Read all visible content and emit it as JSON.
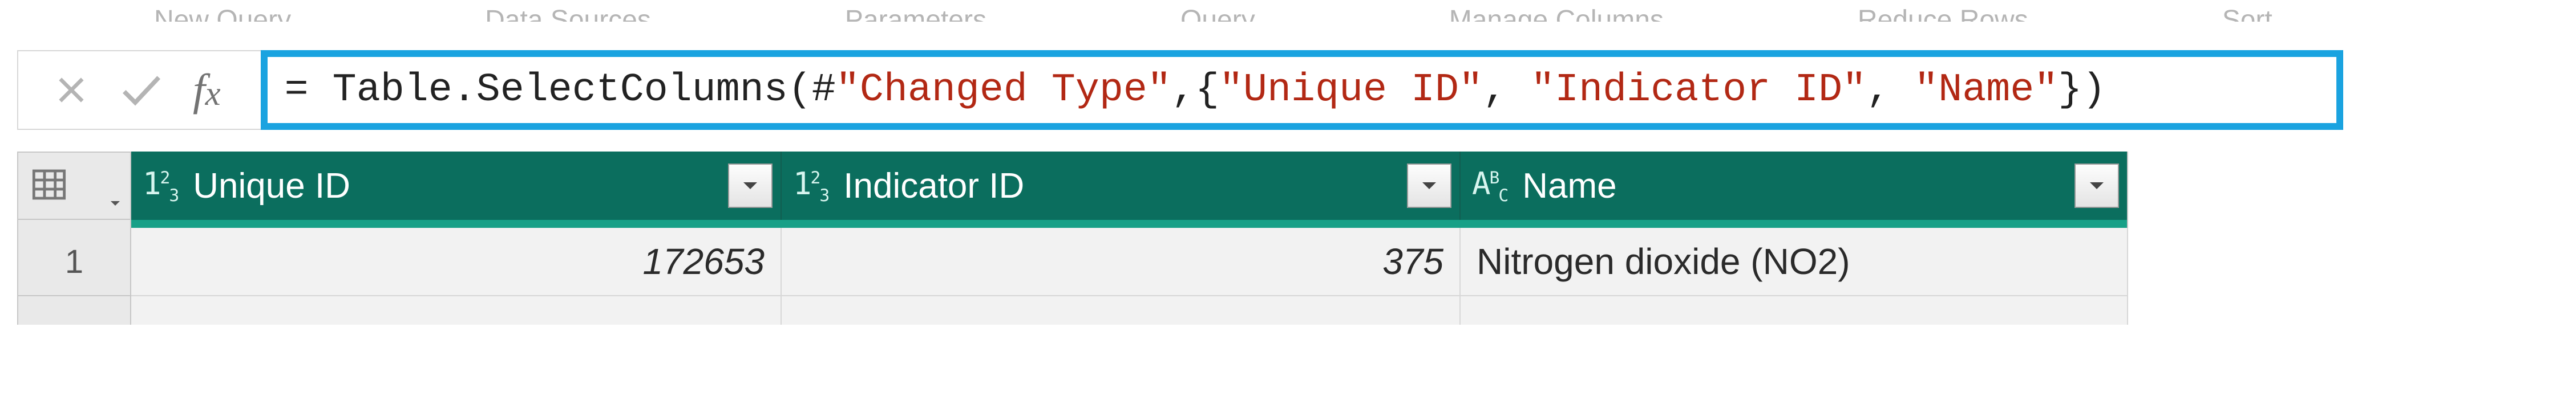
{
  "ribbon": {
    "items": [
      "New Query",
      "Data Sources",
      "Parameters",
      "Query",
      "Manage Columns",
      "Reduce Rows",
      "Sort"
    ]
  },
  "formula": {
    "prefix": "= Table.SelectColumns(#",
    "ref": "\"Changed Type\"",
    "mid": ",{",
    "args": [
      "\"Unique ID\"",
      "\"Indicator ID\"",
      "\"Name\""
    ],
    "sep": ", ",
    "suffix": "})"
  },
  "columns": [
    {
      "label": "Unique ID",
      "type": "number"
    },
    {
      "label": "Indicator ID",
      "type": "number"
    },
    {
      "label": "Name",
      "type": "text"
    }
  ],
  "rows": [
    {
      "n": "1",
      "unique_id": "172653",
      "indicator_id": "375",
      "name": "Nitrogen dioxide (NO2)"
    }
  ]
}
